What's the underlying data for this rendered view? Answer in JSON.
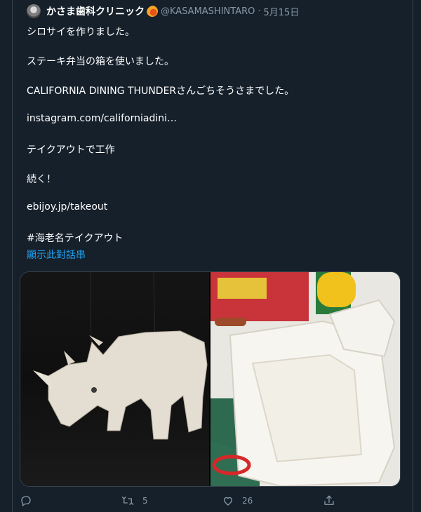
{
  "tweet": {
    "display_name": "かさま歯科クリニック",
    "handle": "@KASAMASHINTARO",
    "separator": "·",
    "date": "5月15日",
    "lines": [
      "シロサイを作りました。",
      "ステーキ弁当の箱を使いました。",
      "CALIFORNIA DINING THUNDERさんごちそうさまでした。",
      "instagram.com/californiadini…",
      "テイクアウトで工作",
      "続く！",
      "ebijoy.jp/takeout",
      "#海老名テイクアウト"
    ],
    "show_thread": "顯示此對話串"
  },
  "actions": {
    "reply_icon": "reply-icon",
    "retweet_icon": "retweet-icon",
    "retweet_count": "5",
    "like_icon": "heart-icon",
    "like_count": "26",
    "share_icon": "share-icon"
  },
  "colors": {
    "background": "#15202b",
    "text": "#ffffff",
    "muted": "#8899a6",
    "link": "#1da1f2",
    "border": "#38444d"
  }
}
